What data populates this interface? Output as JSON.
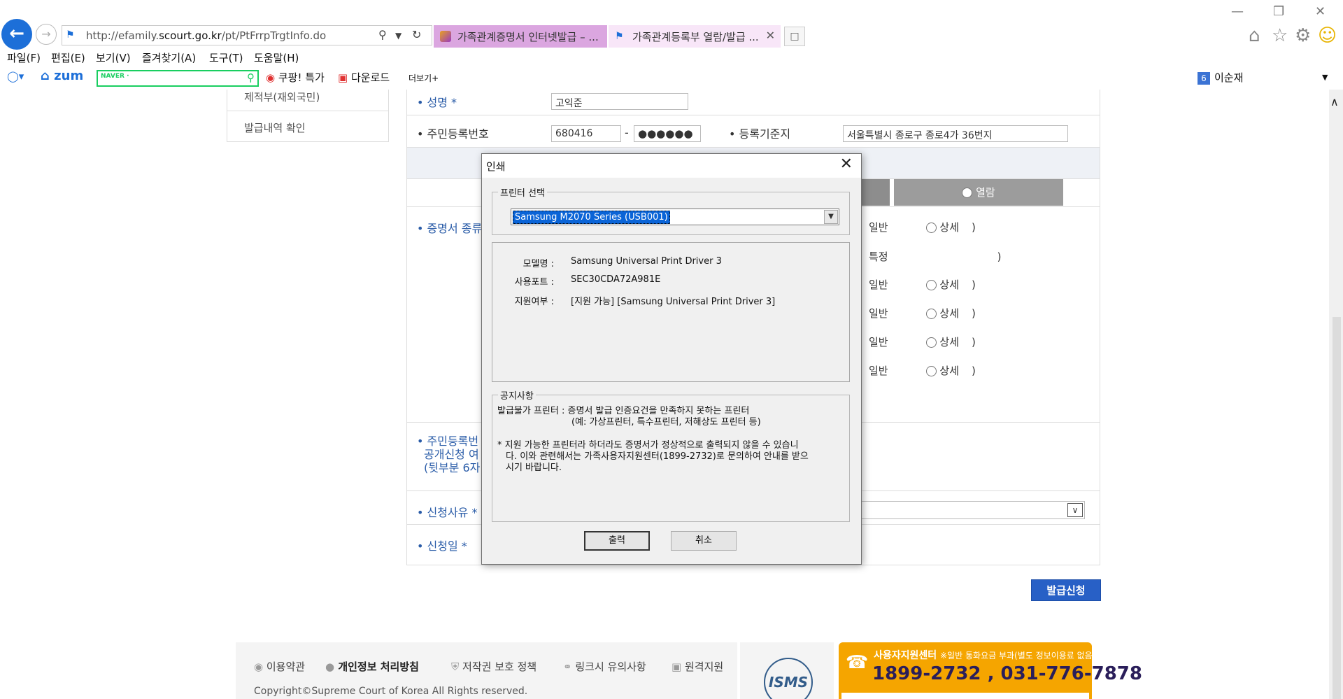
{
  "browser": {
    "url_prefix": "http://efamily.",
    "url_domain": "scourt.go.kr",
    "url_path": "/pt/PtFrrpTrgtInfo.do",
    "tabs": [
      {
        "label": "가족관계증명서 인터넷발급 – ..."
      },
      {
        "label": "가족관계등록부 열람/발급 ..."
      }
    ],
    "menu": [
      "파일(F)",
      "편집(E)",
      "보기(V)",
      "즐겨찾기(A)",
      "도구(T)",
      "도움말(H)"
    ],
    "favorites": {
      "zum": "zum",
      "naver": "NAVER ·",
      "coupang": "쿠팡! 특가",
      "download": "다운로드",
      "more": "더보기+",
      "user_badge": "6",
      "user": "이순재"
    }
  },
  "sidebar": {
    "items": [
      {
        "label": "제적부(재외국민)"
      },
      {
        "label": "발급내역 확인"
      }
    ]
  },
  "form": {
    "name_label": "• 성명 *",
    "name_value": "고익준",
    "rrn_label": "• 주민등록번호",
    "rrn_front": "680416",
    "rrn_dash": "-",
    "rrn_back": "●●●●●●",
    "regbase_label": "• 등록기준지",
    "regbase_value": "서울특별시 종로구 종로4가 36번지",
    "view_tab": "열람",
    "cert_type_label": "• 증명서 종류",
    "options": [
      {
        "a": "일반",
        "b": "상세",
        "c": ")"
      },
      {
        "a": "특정",
        "b": "",
        "c": ")"
      },
      {
        "a": "일반",
        "b": "상세",
        "c": ")"
      },
      {
        "a": "일반",
        "b": "상세",
        "c": ")"
      },
      {
        "a": "일반",
        "b": "상세",
        "c": ")"
      },
      {
        "a": "일반",
        "b": "상세",
        "c": ")"
      }
    ],
    "rrn_public_label_1": "• 주민등록번",
    "rrn_public_label_2": "공개신청 여",
    "rrn_public_label_3": "(뒷부분 6자",
    "reason_label": "• 신청사유 *",
    "date_label": "• 신청일 *",
    "apply_button": "발급신청"
  },
  "footer": {
    "links": [
      "이용약관",
      "개인정보 처리방침",
      "저작권 보호 정책",
      "링크시 유의사항",
      "원격지원"
    ],
    "copyright": "Copyright©Supreme Court of Korea All Rights reserved.",
    "isms": "ISMS",
    "help_title": "사용자지원센터",
    "help_note": "※일반 통화요금 부과(별도 정보이용료 없음)",
    "help_phone": "1899-2732 , 031-776-7878"
  },
  "dialog": {
    "title": "인쇄",
    "printer_group": "프린터 선택",
    "printer_value": "Samsung M2070 Series (USB001)",
    "model_label": "모델명 :",
    "model_value": "Samsung Universal Print Driver 3",
    "port_label": "사용포트 :",
    "port_value": "SEC30CDA72A981E",
    "support_label": "지원여부 :",
    "support_value": "[지원 가능] [Samsung Universal Print Driver 3]",
    "notice_group": "공지사항",
    "notice_l1": "발급불가 프린터 : 증명서 발급 인증요건을 만족하지 못하는 프린터",
    "notice_l2": "(예: 가상프린터, 특수프린터, 저해상도 프린터 등)",
    "notice_l3": "* 지원 가능한 프린터라 하더라도 증명서가 정상적으로 출력되지 않을 수 있습니",
    "notice_l4": "다. 이와 관련해서는 가족사용자지원센터(1899-2732)로 문의하여 안내를 받으",
    "notice_l5": "시기 바랍니다.",
    "print_button": "출력",
    "cancel_button": "취소"
  },
  "colors": {
    "accent": "#2860c6",
    "label_blue": "#2a5ca8",
    "help_orange": "#f5a500"
  }
}
